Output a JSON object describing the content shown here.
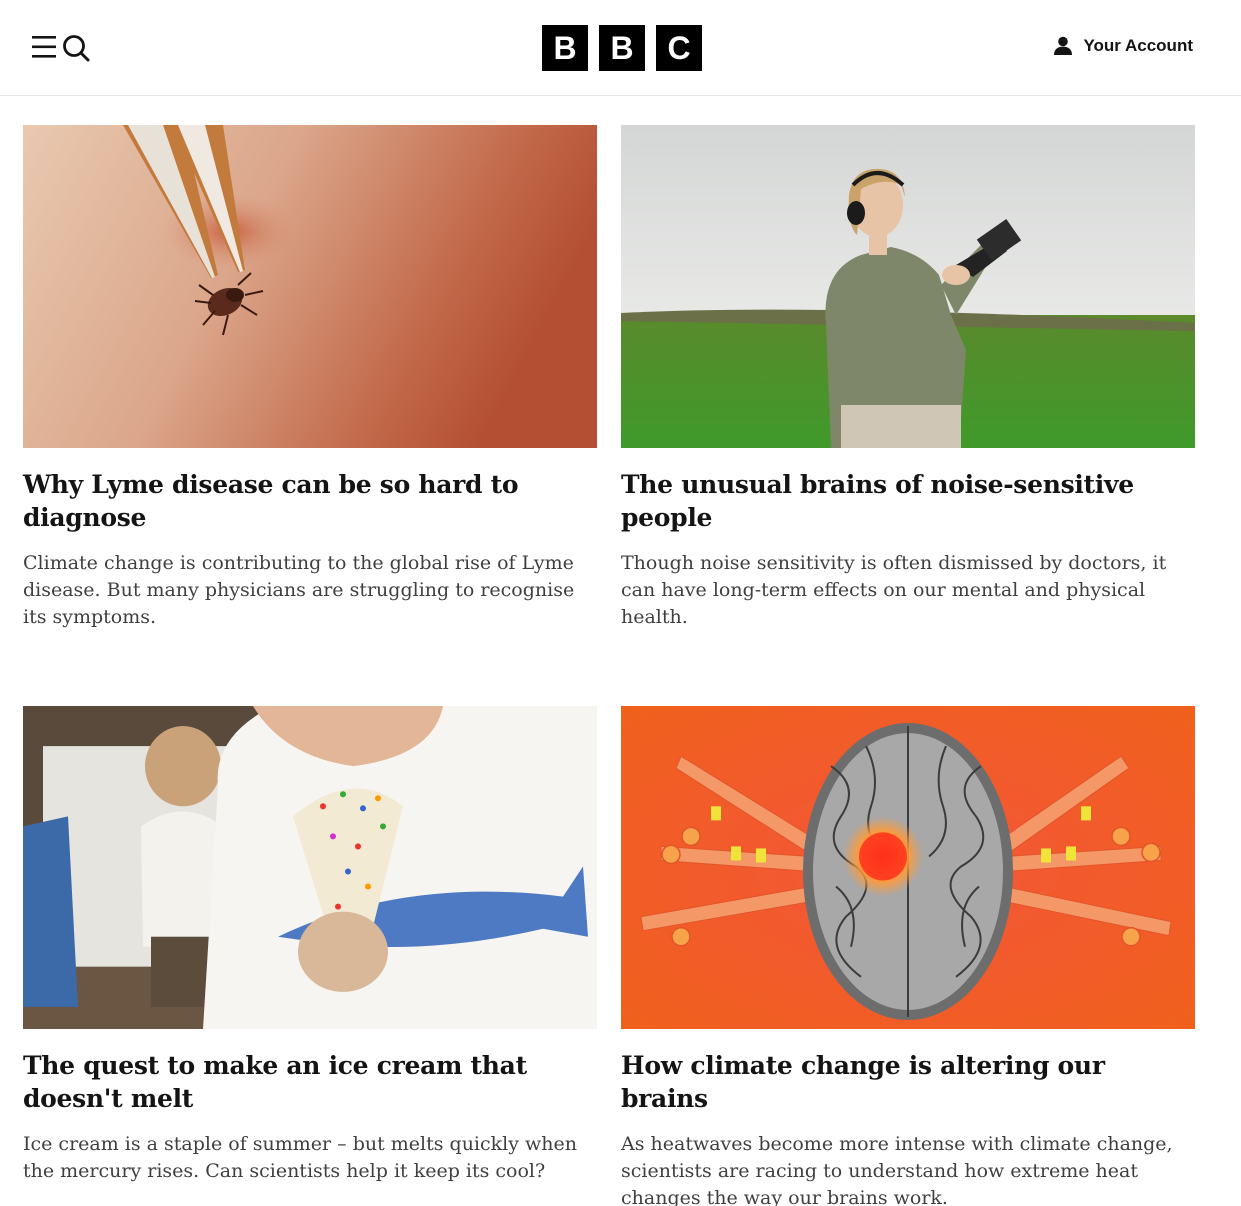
{
  "header": {
    "logo_letters": [
      "B",
      "B",
      "C"
    ],
    "account_label": "Your Account",
    "menu_icon": "menu-icon",
    "search_icon": "search-icon",
    "account_icon": "person-icon"
  },
  "articles": [
    {
      "title": "Why Lyme disease can be so hard to diagnose",
      "summary": "Climate change is contributing to the global rise of Lyme disease. But many physicians are struggling to recognise its symptoms."
    },
    {
      "title": "The unusual brains of noise-sensitive people",
      "summary": "Though noise sensitivity is often dismissed by doctors, it can have long-term effects on our mental and physical health."
    },
    {
      "title": "The quest to make an ice cream that doesn't melt",
      "summary": "Ice cream is a staple of summer – but melts quickly when the mercury rises. Can scientists help it keep its cool?"
    },
    {
      "title": "How climate change is altering our brains",
      "summary": "As heatwaves become more intense with climate change, scientists are racing to understand how extreme heat changes the way our brains work."
    }
  ]
}
